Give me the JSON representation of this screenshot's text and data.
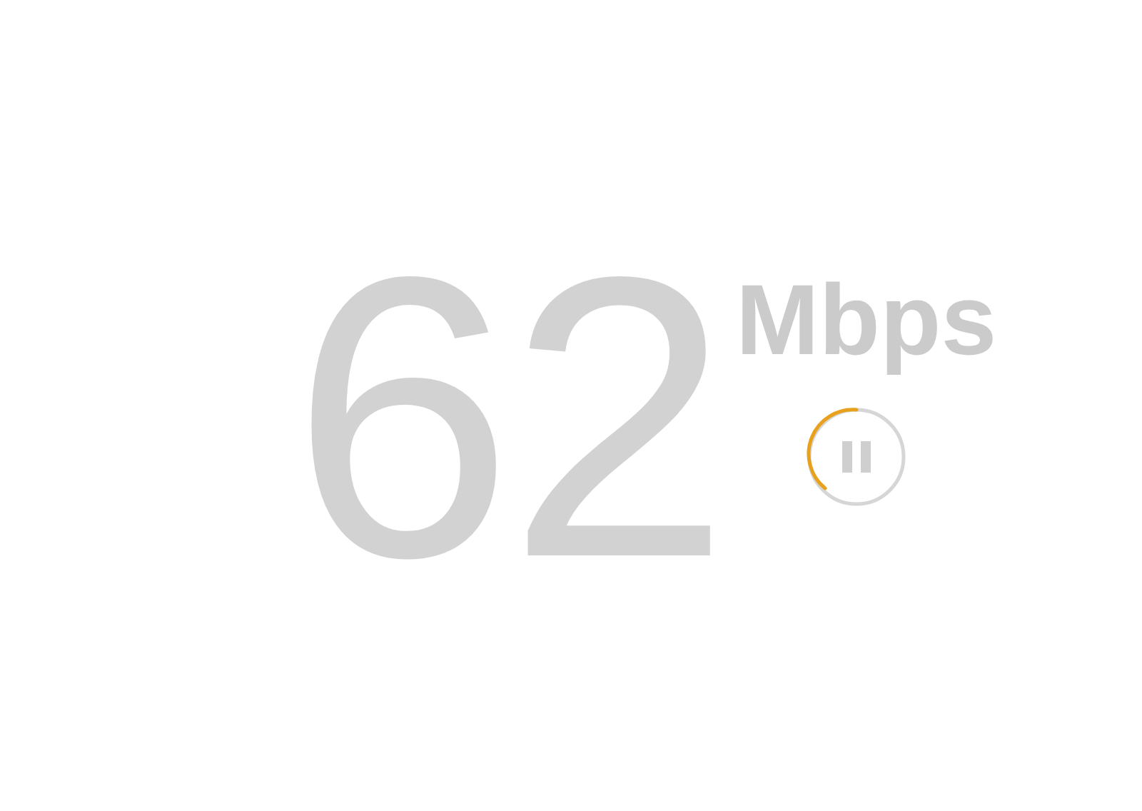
{
  "speed": {
    "value": "62",
    "unit": "Mbps"
  },
  "control": {
    "kind": "pause"
  }
}
